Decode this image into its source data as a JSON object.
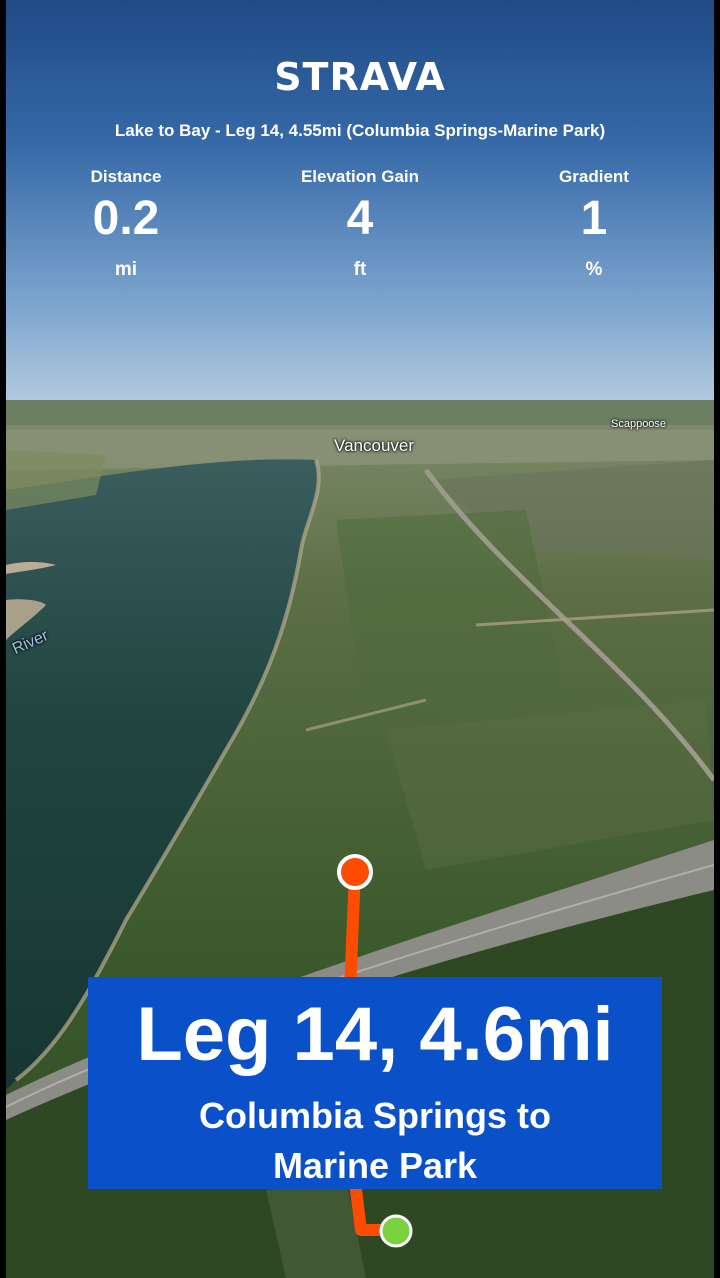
{
  "header": {
    "logo": "STRAVA",
    "route_title": "Lake to Bay - Leg 14, 4.55mi (Columbia Springs-Marine Park)"
  },
  "stats": [
    {
      "label": "Distance",
      "value": "0.2",
      "unit": "mi"
    },
    {
      "label": "Elevation Gain",
      "value": "4",
      "unit": "ft"
    },
    {
      "label": "Gradient",
      "value": "1",
      "unit": "%"
    }
  ],
  "map": {
    "labels": {
      "vancouver": "Vancouver",
      "scappoose": "Scappoose",
      "river": "River"
    },
    "colors": {
      "route": "#fc4c02",
      "start_marker": "#fc4c02",
      "end_marker": "#7ad23e",
      "water": "#1d3f3c"
    }
  },
  "leg": {
    "title": "Leg 14, 4.6mi",
    "subtitle_line1": "Columbia Springs to",
    "subtitle_line2": "Marine Park",
    "box_color": "#0a50c8"
  }
}
